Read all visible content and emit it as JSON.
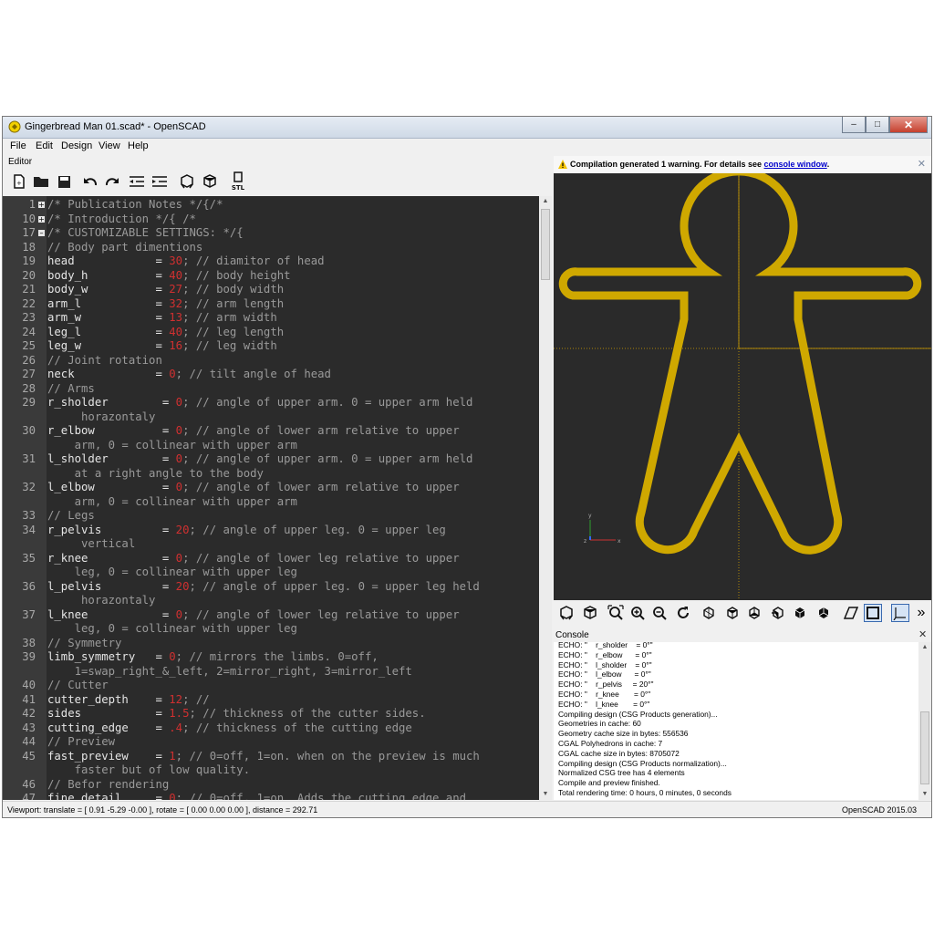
{
  "window": {
    "title": "Gingerbread Man 01.scad* - OpenSCAD",
    "minimize": "–",
    "maximize": "□",
    "close": "✕"
  },
  "menu": [
    "File",
    "Edit",
    "Design",
    "View",
    "Help"
  ],
  "editor": {
    "label": "Editor",
    "lines": [
      {
        "n": "1",
        "fold": "+",
        "parts": [
          {
            "t": "/* Publication Notes */{/*",
            "k": "c"
          }
        ]
      },
      {
        "n": "10",
        "fold": "+",
        "parts": [
          {
            "t": "/* Introduction */{ /*",
            "k": "c"
          }
        ]
      },
      {
        "n": "17",
        "fold": "–",
        "parts": [
          {
            "t": "/* CUSTOMIZABLE SETTINGS: */{",
            "k": "c"
          }
        ]
      },
      {
        "n": "18",
        "parts": [
          {
            "t": "// Body part dimentions",
            "k": "c"
          }
        ]
      },
      {
        "n": "19",
        "parts": [
          {
            "t": "head            = ",
            "k": ""
          },
          {
            "t": "30",
            "k": "n"
          },
          {
            "t": "; // diamitor of head",
            "k": "c"
          }
        ]
      },
      {
        "n": "20",
        "parts": [
          {
            "t": "body_h          = ",
            "k": ""
          },
          {
            "t": "40",
            "k": "n"
          },
          {
            "t": "; // body height",
            "k": "c"
          }
        ]
      },
      {
        "n": "21",
        "parts": [
          {
            "t": "body_w          = ",
            "k": ""
          },
          {
            "t": "27",
            "k": "n"
          },
          {
            "t": "; // body width",
            "k": "c"
          }
        ]
      },
      {
        "n": "22",
        "parts": [
          {
            "t": "arm_l           = ",
            "k": ""
          },
          {
            "t": "32",
            "k": "n"
          },
          {
            "t": "; // arm length",
            "k": "c"
          }
        ]
      },
      {
        "n": "23",
        "parts": [
          {
            "t": "arm_w           = ",
            "k": ""
          },
          {
            "t": "13",
            "k": "n"
          },
          {
            "t": "; // arm width",
            "k": "c"
          }
        ]
      },
      {
        "n": "24",
        "parts": [
          {
            "t": "leg_l           = ",
            "k": ""
          },
          {
            "t": "40",
            "k": "n"
          },
          {
            "t": "; // leg length",
            "k": "c"
          }
        ]
      },
      {
        "n": "25",
        "parts": [
          {
            "t": "leg_w           = ",
            "k": ""
          },
          {
            "t": "16",
            "k": "n"
          },
          {
            "t": "; // leg width",
            "k": "c"
          }
        ]
      },
      {
        "n": "26",
        "parts": [
          {
            "t": "// Joint rotation",
            "k": "c"
          }
        ]
      },
      {
        "n": "27",
        "parts": [
          {
            "t": "neck            = ",
            "k": ""
          },
          {
            "t": "0",
            "k": "n"
          },
          {
            "t": "; // tilt angle of head",
            "k": "c"
          }
        ]
      },
      {
        "n": "28",
        "parts": [
          {
            "t": "// Arms",
            "k": "c"
          }
        ]
      },
      {
        "n": "29",
        "parts": [
          {
            "t": "r_sholder        = ",
            "k": ""
          },
          {
            "t": "0",
            "k": "n"
          },
          {
            "t": "; // angle of upper arm. 0 = upper arm held",
            "k": "c"
          }
        ]
      },
      {
        "n": "",
        "parts": [
          {
            "t": "     horazontaly",
            "k": "c"
          }
        ]
      },
      {
        "n": "30",
        "parts": [
          {
            "t": "r_elbow          = ",
            "k": ""
          },
          {
            "t": "0",
            "k": "n"
          },
          {
            "t": "; // angle of lower arm relative to upper",
            "k": "c"
          }
        ]
      },
      {
        "n": "",
        "parts": [
          {
            "t": "    arm, 0 = collinear with upper arm",
            "k": "c"
          }
        ]
      },
      {
        "n": "31",
        "parts": [
          {
            "t": "l_sholder        = ",
            "k": ""
          },
          {
            "t": "0",
            "k": "n"
          },
          {
            "t": "; // angle of upper arm. 0 = upper arm held",
            "k": "c"
          }
        ]
      },
      {
        "n": "",
        "parts": [
          {
            "t": "    at a right angle to the body",
            "k": "c"
          }
        ]
      },
      {
        "n": "32",
        "parts": [
          {
            "t": "l_elbow          = ",
            "k": ""
          },
          {
            "t": "0",
            "k": "n"
          },
          {
            "t": "; // angle of lower arm relative to upper",
            "k": "c"
          }
        ]
      },
      {
        "n": "",
        "parts": [
          {
            "t": "    arm, 0 = collinear with upper arm",
            "k": "c"
          }
        ]
      },
      {
        "n": "33",
        "parts": [
          {
            "t": "// Legs",
            "k": "c"
          }
        ]
      },
      {
        "n": "34",
        "parts": [
          {
            "t": "r_pelvis         = ",
            "k": ""
          },
          {
            "t": "20",
            "k": "n"
          },
          {
            "t": "; // angle of upper leg. 0 = upper leg",
            "k": "c"
          }
        ]
      },
      {
        "n": "",
        "parts": [
          {
            "t": "     vertical",
            "k": "c"
          }
        ]
      },
      {
        "n": "35",
        "parts": [
          {
            "t": "r_knee           = ",
            "k": ""
          },
          {
            "t": "0",
            "k": "n"
          },
          {
            "t": "; // angle of lower leg relative to upper",
            "k": "c"
          }
        ]
      },
      {
        "n": "",
        "parts": [
          {
            "t": "    leg, 0 = collinear with upper leg",
            "k": "c"
          }
        ]
      },
      {
        "n": "36",
        "parts": [
          {
            "t": "l_pelvis         = ",
            "k": ""
          },
          {
            "t": "20",
            "k": "n"
          },
          {
            "t": "; // angle of upper leg. 0 = upper leg held",
            "k": "c"
          }
        ]
      },
      {
        "n": "",
        "parts": [
          {
            "t": "     horazontaly",
            "k": "c"
          }
        ]
      },
      {
        "n": "37",
        "parts": [
          {
            "t": "l_knee           = ",
            "k": ""
          },
          {
            "t": "0",
            "k": "n"
          },
          {
            "t": "; // angle of lower leg relative to upper",
            "k": "c"
          }
        ]
      },
      {
        "n": "",
        "parts": [
          {
            "t": "    leg, 0 = collinear with upper leg",
            "k": "c"
          }
        ]
      },
      {
        "n": "38",
        "parts": [
          {
            "t": "// Symmetry",
            "k": "c"
          }
        ]
      },
      {
        "n": "39",
        "parts": [
          {
            "t": "limb_symmetry   = ",
            "k": ""
          },
          {
            "t": "0",
            "k": "n"
          },
          {
            "t": "; // mirrors the limbs. 0=off,",
            "k": "c"
          }
        ]
      },
      {
        "n": "",
        "parts": [
          {
            "t": "    1=swap_right_&_left, 2=mirror_right, 3=mirror_left",
            "k": "c"
          }
        ]
      },
      {
        "n": "40",
        "parts": [
          {
            "t": "// Cutter",
            "k": "c"
          }
        ]
      },
      {
        "n": "41",
        "parts": [
          {
            "t": "cutter_depth    = ",
            "k": ""
          },
          {
            "t": "12",
            "k": "n"
          },
          {
            "t": "; //",
            "k": "c"
          }
        ]
      },
      {
        "n": "42",
        "parts": [
          {
            "t": "sides           = ",
            "k": ""
          },
          {
            "t": "1.5",
            "k": "n"
          },
          {
            "t": "; // thickness of the cutter sides.",
            "k": "c"
          }
        ]
      },
      {
        "n": "43",
        "parts": [
          {
            "t": "cutting_edge    = ",
            "k": ""
          },
          {
            "t": ".4",
            "k": "n"
          },
          {
            "t": "; // thickness of the cutting edge",
            "k": "c"
          }
        ]
      },
      {
        "n": "44",
        "parts": [
          {
            "t": "// Preview",
            "k": "c"
          }
        ]
      },
      {
        "n": "45",
        "parts": [
          {
            "t": "fast_preview    = ",
            "k": ""
          },
          {
            "t": "1",
            "k": "n"
          },
          {
            "t": "; // 0=off, 1=on. when on the preview is much",
            "k": "c"
          }
        ]
      },
      {
        "n": "",
        "parts": [
          {
            "t": "    faster but of low quality.",
            "k": "c"
          }
        ]
      },
      {
        "n": "46",
        "parts": [
          {
            "t": "// Befor rendering",
            "k": "c"
          }
        ]
      },
      {
        "n": "47",
        "parts": [
          {
            "t": "fine_detail     = ",
            "k": ""
          },
          {
            "t": "0",
            "k": "n"
          },
          {
            "t": "; // 0=off, 1=on. Adds the cutting edge and",
            "k": "c"
          }
        ]
      }
    ]
  },
  "toolbar": {
    "stl_label": "STL"
  },
  "viewer": {
    "warning_text": "Compilation generated 1 warning. For details see ",
    "warning_link": "console window",
    "warning_tail": ".",
    "close": "✕",
    "axis": {
      "z": "z",
      "y": "y",
      "x": "x"
    },
    "overflow": "»",
    "colors": {
      "cookie": "#cfa800",
      "background": "#2a2a2a",
      "axis": "#d4a300"
    }
  },
  "console": {
    "label": "Console",
    "close": "✕",
    "lines": [
      "ECHO: \"    r_sholder    = 0°\"",
      "ECHO: \"    r_elbow      = 0°\"",
      "ECHO: \"    l_sholder    = 0°\"",
      "ECHO: \"    l_elbow      = 0°\"",
      "ECHO: \"    r_pelvis     = 20°\"",
      "ECHO: \"    r_knee       = 0°\"",
      "ECHO: \"    l_knee       = 0°\"",
      "Compiling design (CSG Products generation)...",
      "Geometries in cache: 60",
      "Geometry cache size in bytes: 556536",
      "CGAL Polyhedrons in cache: 7",
      "CGAL cache size in bytes: 8705072",
      "Compiling design (CSG Products normalization)...",
      "Normalized CSG tree has 4 elements",
      "Compile and preview finished.",
      "Total rendering time: 0 hours, 0 minutes, 0 seconds"
    ]
  },
  "status": {
    "viewport": "Viewport: translate = [ 0.91 -5.29 -0.00 ], rotate = [ 0.00 0.00 0.00 ], distance = 292.71",
    "version": "OpenSCAD 2015.03"
  }
}
